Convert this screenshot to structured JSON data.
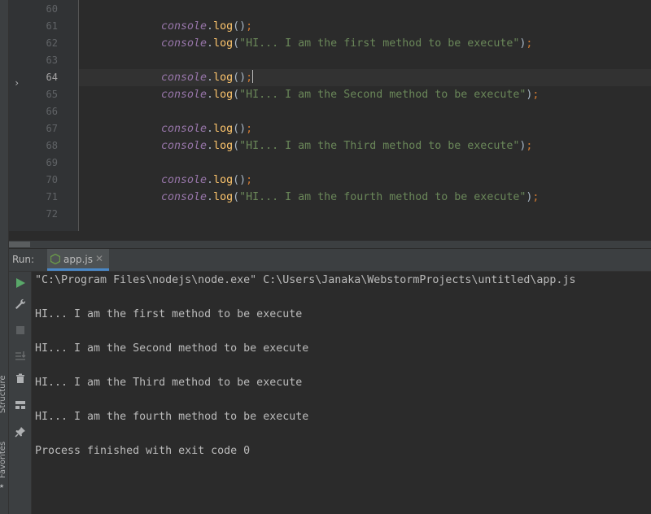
{
  "editor": {
    "line_numbers": [
      "60",
      "61",
      "62",
      "63",
      "64",
      "65",
      "66",
      "67",
      "68",
      "69",
      "70",
      "71",
      "72"
    ],
    "lines": [
      {
        "num": "61",
        "obj": "console",
        "dot": ".",
        "fn": "log",
        "args": "()",
        "semi": ";"
      },
      {
        "num": "62",
        "obj": "console",
        "dot": ".",
        "fn": "log",
        "open": "(",
        "str": "\"HI... I am the first method to be execute\"",
        "close": ")",
        "semi": ";"
      },
      {
        "num": "64",
        "obj": "console",
        "dot": ".",
        "fn": "log",
        "args": "()",
        "semi": ";"
      },
      {
        "num": "65",
        "obj": "console",
        "dot": ".",
        "fn": "log",
        "open": "(",
        "str": "\"HI... I am the Second method to be execute\"",
        "close": ")",
        "semi": ";"
      },
      {
        "num": "67",
        "obj": "console",
        "dot": ".",
        "fn": "log",
        "args": "()",
        "semi": ";"
      },
      {
        "num": "68",
        "obj": "console",
        "dot": ".",
        "fn": "log",
        "open": "(",
        "str": "\"HI... I am the Third method to be execute\"",
        "close": ")",
        "semi": ";"
      },
      {
        "num": "70",
        "obj": "console",
        "dot": ".",
        "fn": "log",
        "args": "()",
        "semi": ";"
      },
      {
        "num": "71",
        "obj": "console",
        "dot": ".",
        "fn": "log",
        "open": "(",
        "str": "\"HI... I am the fourth method to be execute\"",
        "close": ")",
        "semi": ";"
      }
    ]
  },
  "sidebar": {
    "structure_label": "Structure",
    "favorites_label": "Favorites"
  },
  "run": {
    "label": "Run:",
    "tab_label": "app.js",
    "output": [
      "\"C:\\Program Files\\nodejs\\node.exe\" C:\\Users\\Janaka\\WebstormProjects\\untitled\\app.js",
      "",
      "HI... I am the first method to be execute",
      "",
      "HI... I am the Second method to be execute",
      "",
      "HI... I am the Third method to be execute",
      "",
      "HI... I am the fourth method to be execute",
      "",
      "Process finished with exit code 0"
    ]
  },
  "colors": {
    "keyword_object": "#9876aa",
    "function": "#ffc66d",
    "string": "#6a8759",
    "semicolon": "#cc7832",
    "run_icon": "#59a869"
  },
  "icons": [
    "run-icon",
    "wrench-icon",
    "stop-icon",
    "scroll-to-end-icon",
    "trash-icon",
    "layout-icon",
    "pin-icon",
    "node-icon",
    "close-icon",
    "chevron-right-icon",
    "star-icon"
  ]
}
